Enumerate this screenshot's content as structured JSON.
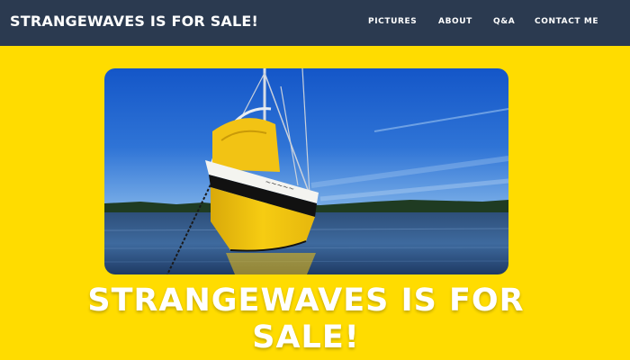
{
  "header": {
    "site_title": "STRANGEWAVES IS FOR SALE!",
    "nav": [
      {
        "label": "PICTURES"
      },
      {
        "label": "ABOUT"
      },
      {
        "label": "Q&A"
      },
      {
        "label": "CONTACT ME"
      }
    ]
  },
  "hero": {
    "image_subject": "sailboat-photo",
    "headline_line1": "STRANGEWAVES IS FOR",
    "headline_line2": "SALE!"
  },
  "colors": {
    "page_background": "#ffdc00",
    "navbar_background": "#2b3a50",
    "nav_text": "#ffffff",
    "headline_text": "#ffffff",
    "hull_yellow": "#f6cc12"
  }
}
